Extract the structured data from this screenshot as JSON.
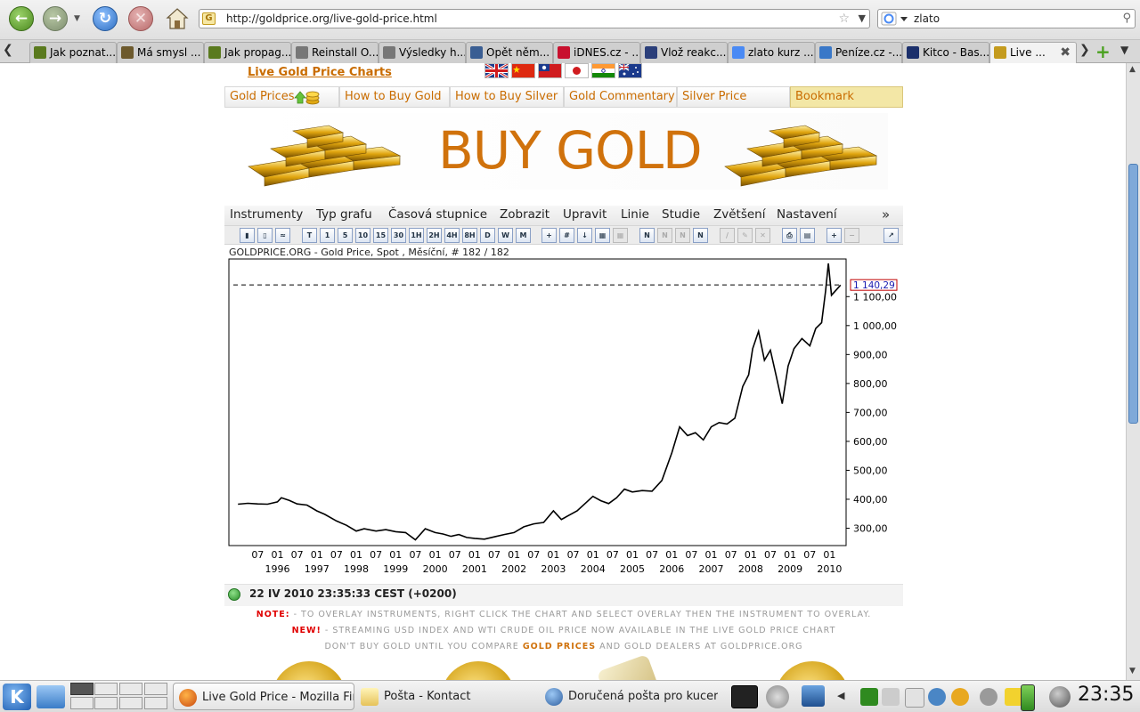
{
  "browser": {
    "url": "http://goldprice.org/live-gold-price.html",
    "search_query": "zlato",
    "tabs": [
      {
        "label": "Jak poznat...",
        "color": "#5a7a1e"
      },
      {
        "label": "Má smysl ...",
        "color": "#6d5a2d"
      },
      {
        "label": "Jak propag...",
        "color": "#5a7a1e"
      },
      {
        "label": "Reinstall O...",
        "color": "#777777"
      },
      {
        "label": "Výsledky h...",
        "color": "#777777"
      },
      {
        "label": "Opět něm...",
        "color": "#3a5e93"
      },
      {
        "label": "iDNES.cz - ...",
        "color": "#c8102e"
      },
      {
        "label": "Vlož reakc...",
        "color": "#2b3f7a"
      },
      {
        "label": "zlato kurz ...",
        "color": "#4a8af4"
      },
      {
        "label": "Peníze.cz -...",
        "color": "#3a78c8"
      },
      {
        "label": "Kitco - Bas...",
        "color": "#1b2f6b"
      },
      {
        "label": "Live ...",
        "color": "#c49b1e"
      }
    ]
  },
  "site": {
    "title_link": "Live Gold Price Charts",
    "nav": [
      "Gold Prices",
      "How to Buy Gold",
      "How to Buy Silver",
      "Gold Commentary",
      "Silver Price",
      "Bookmark"
    ],
    "banner_text": "BUY GOLD"
  },
  "chart_menu": [
    "Instrumenty",
    "Typ grafu",
    "Časová stupnice",
    "Zobrazit",
    "Upravit",
    "Linie",
    "Studie",
    "Zvětšení",
    "Nastavení"
  ],
  "chart_toolbar_periods": [
    "T",
    "1",
    "5",
    "10",
    "15",
    "30",
    "1H",
    "2H",
    "4H",
    "8H",
    "D",
    "W",
    "M"
  ],
  "chart_caption": "GOLDPRICE.ORG - Gold Price, Spot , Měsíční, # 182 / 182",
  "status_time": "22 IV 2010 23:35:33  CEST (+0200)",
  "notes": {
    "line1_label": "NOTE:",
    "line1_text": " - TO OVERLAY INSTRUMENTS, RIGHT CLICK THE CHART AND SELECT OVERLAY THEN THE INSTRUMENT TO OVERLAY.",
    "line2_label": "NEW!",
    "line2_text": " - STREAMING USD INDEX AND WTI CRUDE OIL PRICE NOW AVAILABLE IN THE LIVE GOLD PRICE CHART",
    "line3_a": "DON'T BUY GOLD UNTIL YOU COMPARE ",
    "line3_gold": "GOLD PRICES",
    "line3_b": " AND GOLD DEALERS AT GOLDPRICE.ORG"
  },
  "taskbar": {
    "tasks": [
      "Live Gold Price - Mozilla Fire",
      "Pošta - Kontact",
      "Doručená pošta pro kucera"
    ],
    "clock": "23:35"
  },
  "chart_data": {
    "type": "line",
    "title": "GOLDPRICE.ORG - Gold Price, Spot , Měsíční, # 182 / 182",
    "current_value_label": "1 140,29",
    "current_value": 1140.29,
    "ylim": [
      240,
      1230
    ],
    "y_ticks": [
      300,
      400,
      500,
      600,
      700,
      800,
      900,
      1000,
      1100
    ],
    "y_tick_labels": [
      "300,00",
      "400,00",
      "500,00",
      "600,00",
      "700,00",
      "800,00",
      "900,00",
      "1 000,00",
      "1 100,00"
    ],
    "x_month_labels": [
      "07",
      "01",
      "07",
      "01",
      "07",
      "01",
      "07",
      "01",
      "07",
      "01",
      "07",
      "01",
      "07",
      "01",
      "07",
      "01",
      "07",
      "01",
      "07",
      "01",
      "07",
      "01",
      "07",
      "01",
      "07",
      "01",
      "07",
      "01",
      "07",
      "01"
    ],
    "x_year_labels": [
      "1996",
      "1997",
      "1998",
      "1999",
      "2000",
      "2001",
      "2002",
      "2003",
      "2004",
      "2005",
      "2006",
      "2007",
      "2008",
      "2009",
      "2010"
    ],
    "series": [
      {
        "values": [
          [
            1995.0,
            383
          ],
          [
            1995.25,
            386
          ],
          [
            1995.5,
            384
          ],
          [
            1995.75,
            383
          ],
          [
            1996.0,
            391
          ],
          [
            1996.1,
            405
          ],
          [
            1996.3,
            396
          ],
          [
            1996.5,
            384
          ],
          [
            1996.75,
            380
          ],
          [
            1997.0,
            360
          ],
          [
            1997.2,
            348
          ],
          [
            1997.5,
            325
          ],
          [
            1997.75,
            310
          ],
          [
            1998.0,
            290
          ],
          [
            1998.2,
            298
          ],
          [
            1998.5,
            290
          ],
          [
            1998.75,
            295
          ],
          [
            1999.0,
            288
          ],
          [
            1999.25,
            285
          ],
          [
            1999.5,
            260
          ],
          [
            1999.75,
            298
          ],
          [
            2000.0,
            285
          ],
          [
            2000.2,
            280
          ],
          [
            2000.4,
            272
          ],
          [
            2000.6,
            278
          ],
          [
            2000.8,
            268
          ],
          [
            2001.0,
            265
          ],
          [
            2001.25,
            262
          ],
          [
            2001.5,
            270
          ],
          [
            2001.75,
            278
          ],
          [
            2002.0,
            285
          ],
          [
            2002.25,
            305
          ],
          [
            2002.5,
            315
          ],
          [
            2002.75,
            320
          ],
          [
            2003.0,
            360
          ],
          [
            2003.2,
            330
          ],
          [
            2003.4,
            345
          ],
          [
            2003.6,
            360
          ],
          [
            2003.8,
            385
          ],
          [
            2004.0,
            410
          ],
          [
            2004.2,
            395
          ],
          [
            2004.4,
            385
          ],
          [
            2004.6,
            405
          ],
          [
            2004.8,
            435
          ],
          [
            2005.0,
            425
          ],
          [
            2005.25,
            430
          ],
          [
            2005.5,
            428
          ],
          [
            2005.75,
            465
          ],
          [
            2006.0,
            560
          ],
          [
            2006.2,
            650
          ],
          [
            2006.4,
            620
          ],
          [
            2006.6,
            630
          ],
          [
            2006.8,
            605
          ],
          [
            2007.0,
            650
          ],
          [
            2007.2,
            665
          ],
          [
            2007.4,
            660
          ],
          [
            2007.6,
            680
          ],
          [
            2007.8,
            790
          ],
          [
            2007.95,
            830
          ],
          [
            2008.05,
            920
          ],
          [
            2008.2,
            980
          ],
          [
            2008.35,
            880
          ],
          [
            2008.5,
            915
          ],
          [
            2008.65,
            825
          ],
          [
            2008.8,
            730
          ],
          [
            2008.95,
            860
          ],
          [
            2009.1,
            920
          ],
          [
            2009.3,
            955
          ],
          [
            2009.5,
            930
          ],
          [
            2009.65,
            990
          ],
          [
            2009.8,
            1010
          ],
          [
            2009.9,
            1120
          ],
          [
            2009.97,
            1215
          ],
          [
            2010.05,
            1105
          ],
          [
            2010.15,
            1120
          ],
          [
            2010.28,
            1140
          ]
        ]
      }
    ]
  }
}
